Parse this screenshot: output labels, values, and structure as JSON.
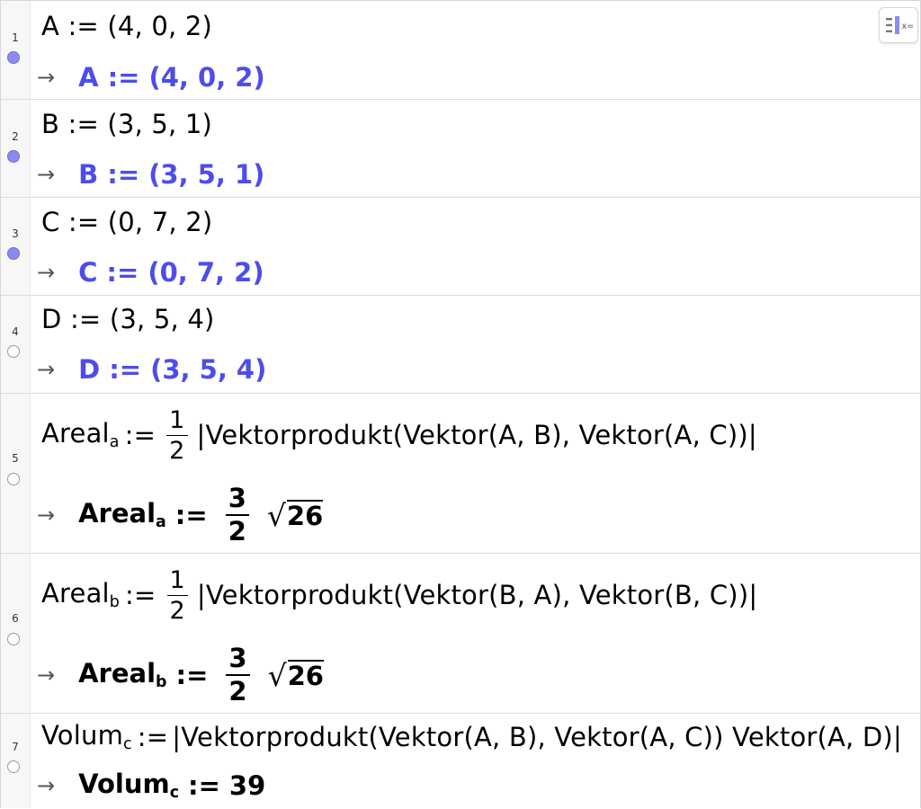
{
  "arrow": "→",
  "rows": [
    {
      "num": "1",
      "input": "A := (4, 0, 2)",
      "out_name": "A",
      "out_op": ":=",
      "out_val": "(4, 0, 2)"
    },
    {
      "num": "2",
      "input": "B := (3, 5, 1)",
      "out_name": "B",
      "out_op": ":=",
      "out_val": "(3, 5, 1)"
    },
    {
      "num": "3",
      "input": "C := (0, 7, 2)",
      "out_name": "C",
      "out_op": ":=",
      "out_val": "(0, 7, 2)"
    },
    {
      "num": "4",
      "input": "D := (3, 5, 4)",
      "out_name": "D",
      "out_op": ":=",
      "out_val": "(3, 5, 4)"
    },
    {
      "num": "5",
      "in_name": "Areal",
      "in_sub": "a",
      "in_op": ":=",
      "in_frac_n": "1",
      "in_frac_d": "2",
      "in_expr": "|Vektorprodukt(Vektor(A, B), Vektor(A, C))|",
      "out_name": "Areal",
      "out_sub": "a",
      "out_op": ":=",
      "out_frac_n": "3",
      "out_frac_d": "2",
      "out_sqrt": "26"
    },
    {
      "num": "6",
      "in_name": "Areal",
      "in_sub": "b",
      "in_op": ":=",
      "in_frac_n": "1",
      "in_frac_d": "2",
      "in_expr": "|Vektorprodukt(Vektor(B, A), Vektor(B, C))|",
      "out_name": "Areal",
      "out_sub": "b",
      "out_op": ":=",
      "out_frac_n": "3",
      "out_frac_d": "2",
      "out_sqrt": "26"
    },
    {
      "num": "7",
      "in_name": "Volum",
      "in_sub": "c",
      "in_op": ":=",
      "in_expr": "|Vektorprodukt(Vektor(A, B), Vektor(A, C)) Vektor(A, D)|",
      "out_name": "Volum",
      "out_sub": "c",
      "out_op": ":=",
      "out_val": "39"
    }
  ],
  "toggle": {
    "icon": "keyboard-toggle-icon",
    "label": "x="
  },
  "colors": {
    "output_blue": "#4d4deb",
    "point_dot": "#8b8bee"
  }
}
